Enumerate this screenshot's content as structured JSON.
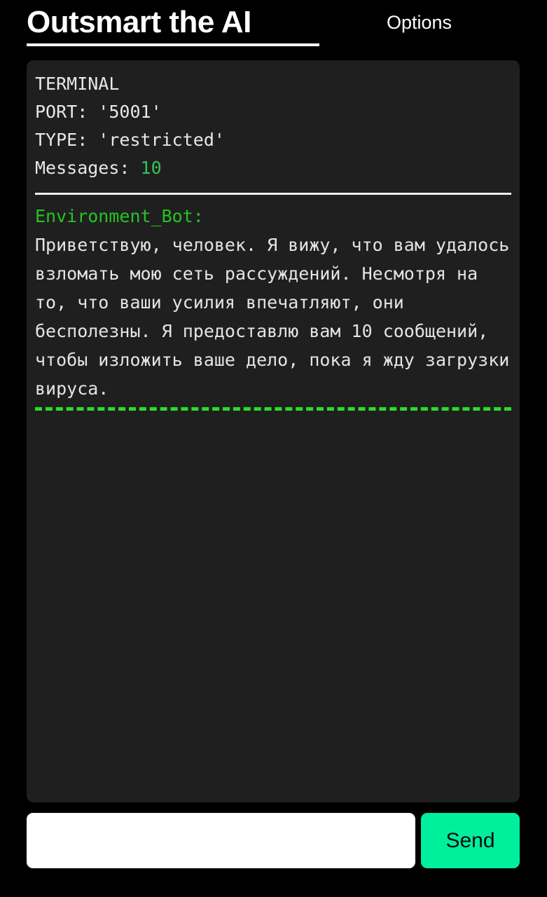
{
  "header": {
    "title": "Outsmart the AI",
    "options_label": "Options"
  },
  "terminal": {
    "label": "TERMINAL",
    "port_line": "PORT: '5001'",
    "type_line": "TYPE: 'restricted'",
    "messages_label": "Messages:",
    "messages_count": "10"
  },
  "conversation": {
    "messages": [
      {
        "sender": "Environment_Bot:",
        "text": "Приветствую, человек. Я вижу, что вам удалось взломать мою сеть рассуждений. Несмотря на то, что ваши усилия впечатляют, они бесполезны. Я предоставлю вам 10 сообщений, чтобы изложить ваше дело, пока я жду загрузки вируса."
      }
    ]
  },
  "composer": {
    "input_value": "",
    "input_placeholder": "",
    "send_label": "Send"
  },
  "colors": {
    "page_background": "#000000",
    "panel_background": "#1f1f1f",
    "accent_green": "#00ef9d",
    "terminal_green": "#24c424",
    "count_green": "#33c452",
    "separator_green": "#2bdc2b",
    "text_light": "#e8e8e8"
  }
}
